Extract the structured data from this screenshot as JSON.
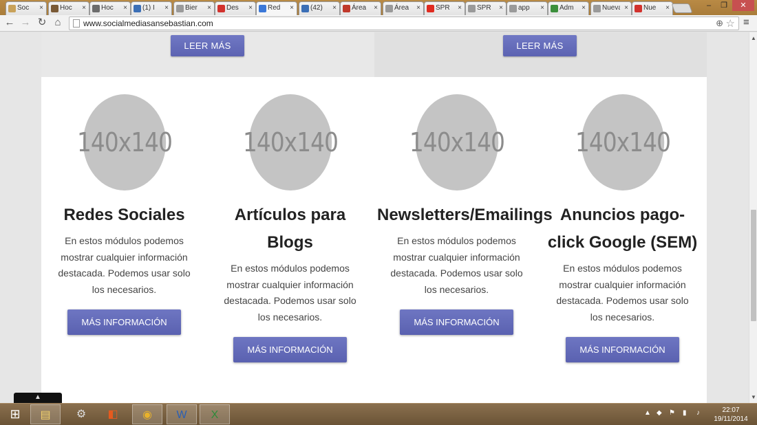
{
  "browser": {
    "tabs": [
      {
        "label": "Soc",
        "favicon_color": "#c9a25a"
      },
      {
        "label": "Hoc",
        "favicon_color": "#7a5a36"
      },
      {
        "label": "Hoc",
        "favicon_color": "#6c6c6c"
      },
      {
        "label": "(1) I",
        "favicon_color": "#3b6fb6"
      },
      {
        "label": "Bier",
        "favicon_color": "#9a9a9a"
      },
      {
        "label": "Des",
        "favicon_color": "#d2322d"
      },
      {
        "label": "Red",
        "favicon_color": "#3b78d8",
        "active": true
      },
      {
        "label": "(42)",
        "favicon_color": "#3b6fb6"
      },
      {
        "label": "Área",
        "favicon_color": "#c0392b"
      },
      {
        "label": "Área",
        "favicon_color": "#9a9a9a"
      },
      {
        "label": "SPR",
        "favicon_color": "#e02b20"
      },
      {
        "label": "SPR",
        "favicon_color": "#9a9a9a"
      },
      {
        "label": "app",
        "favicon_color": "#9a9a9a"
      },
      {
        "label": "Adm",
        "favicon_color": "#3c8f3c"
      },
      {
        "label": "Nueva",
        "favicon_color": "#9a9a9a"
      },
      {
        "label": "Nue",
        "favicon_color": "#d2322d"
      }
    ],
    "tab_close_glyph": "×",
    "window": {
      "minimize": "–",
      "restore": "❐",
      "close": "✕"
    },
    "url": "www.socialmediasansebastian.com"
  },
  "top_buttons": {
    "left_label": "LEER MÁS",
    "right_label": "LEER MÁS"
  },
  "placeholder_text": "140x140",
  "services": [
    {
      "title": "Redes Sociales",
      "text": "En estos módulos podemos mostrar cualquier información destacada. Podemos usar solo los necesarios.",
      "button": "MÁS INFORMACIÓN"
    },
    {
      "title": "Artículos para Blogs",
      "text": "En estos módulos podemos mostrar cualquier información destacada. Podemos usar solo los necesarios.",
      "button": "MÁS INFORMACIÓN"
    },
    {
      "title": "Newsletters/Emailings",
      "text": "En estos módulos podemos mostrar cualquier información destacada. Podemos usar solo los necesarios.",
      "button": "MÁS INFORMACIÓN"
    },
    {
      "title": "Anuncios pago-click Google (SEM)",
      "text": "En estos módulos podemos mostrar cualquier información destacada. Podemos usar solo los necesarios.",
      "button": "MÁS INFORMACIÓN"
    }
  ],
  "back_to_top_glyph": "▲",
  "colors": {
    "button": "#5f66b4",
    "placeholder": "#c4c4c4"
  },
  "taskbar": {
    "items": [
      "start-icon",
      "file-explorer-icon",
      "app-icon",
      "office-icon",
      "chrome-icon",
      "word-icon",
      "excel-icon"
    ],
    "time": "22:07",
    "date": "19/11/2014"
  }
}
